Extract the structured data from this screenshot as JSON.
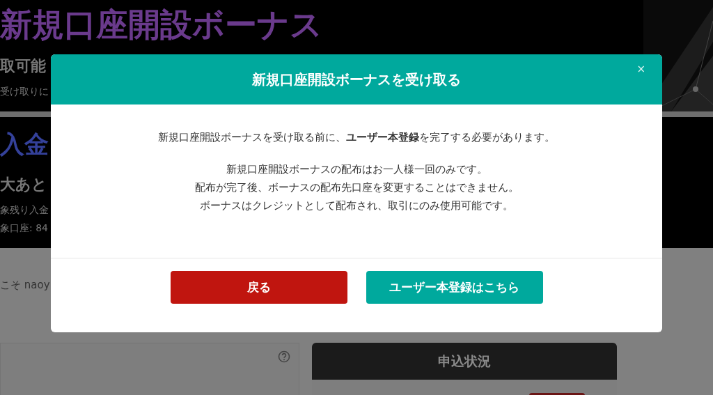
{
  "background": {
    "hero_title": "新規口座開設ボーナス",
    "hero_subtitle": "取可能",
    "hero_note": "受け取りに",
    "deposit_title": "入金",
    "deposit_subtitle": "大あと",
    "deposit_line_1": "象残り入金",
    "deposit_line_2": "象口座: 84",
    "welcome": "こそ naoy",
    "status_panel_title": "申込状況"
  },
  "modal": {
    "title": "新規口座開設ボーナスを受け取る",
    "close": "×",
    "message": "新規口座開設ボーナスを受け取る前に、**ユーザー本登録**を完了する必要があります。",
    "notes": [
      "新規口座開設ボーナスの配布はお一人様一回のみです。",
      "配布が完了後、ボーナスの配布先口座を変更することはできません。",
      "ボーナスはクレジットとして配布され、取引にのみ使用可能です。"
    ],
    "buttons": [
      {
        "label": "戻る",
        "kind": "back"
      },
      {
        "label": "ユーザー本登録はこちら",
        "kind": "register"
      }
    ]
  }
}
